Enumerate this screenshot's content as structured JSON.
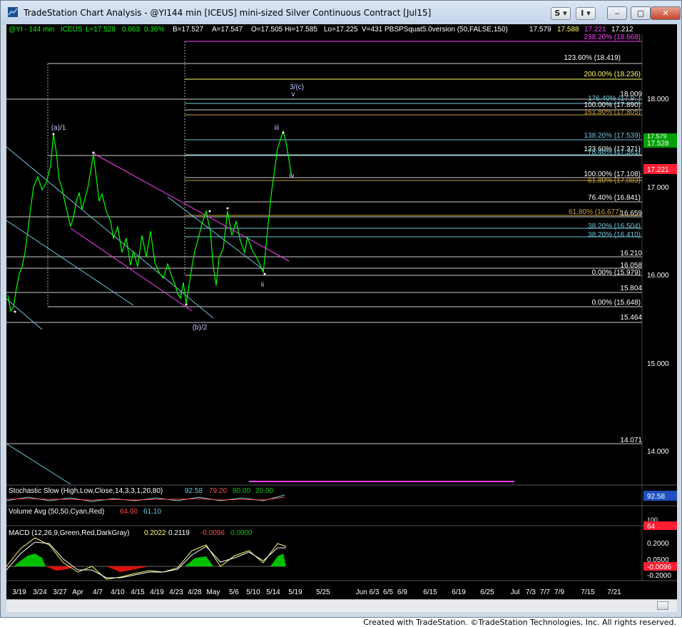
{
  "window": {
    "title": "TradeStation Chart Analysis - @YI144 min [ICEUS] mini-sized Silver Continuous Contract [Jul15]",
    "s_button": "S",
    "i_button": "I",
    "minimize": "‒",
    "maximize": "▢",
    "close": "✕"
  },
  "header": {
    "symbol": "@YI - 144 min",
    "exchange": "ICEUS",
    "last": "L=17.528",
    "change": "0.063",
    "change_pct": "0.36%",
    "bid": "B=17.527",
    "ask": "A=17.547",
    "open": "O=17.505",
    "high": "Hi=17.585",
    "low": "Lo=17.225",
    "volume": "V=431",
    "study": "PBSPSquat5.0version (50,FALSE,150)",
    "study_values": [
      "17.579",
      "17.588",
      "17.221",
      "17.212"
    ]
  },
  "price_axis": {
    "ticks": [
      "18.000",
      "17.000",
      "16.000",
      "15.000",
      "14.000"
    ],
    "last_price": "17.528",
    "last_price_top": "17.579",
    "low_marker": "17.221",
    "colors": {
      "last": "#00c000",
      "low": "#ff1e32"
    }
  },
  "fib_levels": [
    {
      "label": "238.20% (18.668)",
      "color": "#ff40ff"
    },
    {
      "label": "123.60% (18.419)",
      "color": "#ffffff"
    },
    {
      "label": "200.00% (18.236)",
      "color": "#ffff66"
    },
    {
      "label": "18.009",
      "color": "#ffffff"
    },
    {
      "label": "176.40% (17.9..)",
      "color": "#6fc8dc"
    },
    {
      "label": "100.00% (17.890)",
      "color": "#ffffff"
    },
    {
      "label": "161.80% (17.805)",
      "color": "#c8a040"
    },
    {
      "label": "138.20% (17.539)",
      "color": "#6fc8dc"
    },
    {
      "label": "123.60% (17.371)",
      "color": "#ffffff"
    },
    {
      "label": "78.40% (17.361)",
      "color": "#6fc8dc"
    },
    {
      "label": "100.00% (17.108)",
      "color": "#ffffff"
    },
    {
      "label": "61.80% (17.083)",
      "color": "#c8a040"
    },
    {
      "label": "76.40% (16.841)",
      "color": "#ffffff"
    },
    {
      "label": "61.80% (16.677)",
      "color": "#c8a040"
    },
    {
      "label": "16.659",
      "color": "#ffffff"
    },
    {
      "label": "38.20% (16.504)",
      "color": "#6fc8dc"
    },
    {
      "label": "38.20% (16.410)",
      "color": "#6fc8dc"
    },
    {
      "label": "16.210",
      "color": "#ffffff"
    },
    {
      "label": "16.058",
      "color": "#ffffff"
    },
    {
      "label": "0.00% (15.979)",
      "color": "#ffffff"
    },
    {
      "label": "15.804",
      "color": "#ffffff"
    },
    {
      "label": "0.00% (15.648)",
      "color": "#ffffff"
    },
    {
      "label": "15.464",
      "color": "#ffffff"
    },
    {
      "label": "14.071",
      "color": "#ffffff"
    }
  ],
  "wave_labels": [
    "(a)/1",
    "(b)/2",
    "3/(c)",
    "v",
    "iii",
    "iv",
    "ii"
  ],
  "indicators": {
    "stochastic": {
      "label": "Stochastic Slow (High,Low,Close,14,3,3,1,20,80)",
      "values": [
        "92.58",
        "79.20",
        "80.00",
        "20.00"
      ],
      "axis_value": "92.58"
    },
    "volume": {
      "label": "Volume Avg (50,50,Cyan,Red)",
      "values": [
        "64.00",
        "61.10"
      ],
      "axis_top": "100",
      "axis_value": "64"
    },
    "macd": {
      "label": "MACD (12,26,9,Green,Red,DarkGray)",
      "values": [
        "0.2022",
        "0.2119",
        "-0.0096",
        "0.0000"
      ],
      "axis_ticks": [
        "0.2000",
        "0.0500",
        "-0.0096",
        "-0.2000"
      ]
    }
  },
  "date_axis": [
    "3/19",
    "3/24",
    "3/27",
    "Apr",
    "4/7",
    "4/10",
    "4/15",
    "4/19",
    "4/23",
    "4/28",
    "May",
    "5/6",
    "5/10",
    "5/14",
    "5/19",
    "5/25",
    "Jun 6/3",
    "6/5",
    "6/9",
    "6/15",
    "6/19",
    "6/25",
    "Jul",
    "7/3",
    "7/7",
    "7/9",
    "7/15",
    "7/21"
  ],
  "footer": "Created with TradeStation. ©TradeStation Technologies, Inc. All rights reserved."
}
